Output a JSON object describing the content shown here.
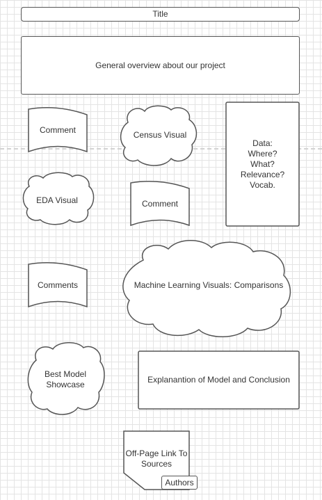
{
  "diagram": {
    "title": "Title",
    "overview": "General overview about our project",
    "comment_1": "Comment",
    "census_visual": "Census Visual",
    "data_box": {
      "line1": "Data:",
      "line2": "Where?",
      "line3": "What?",
      "line4": "Relevance?",
      "line5": "Vocab."
    },
    "eda_visual": "EDA Visual",
    "comment_2": "Comment",
    "comments": "Comments",
    "ml_visuals": "Machine Learning Visuals: Comparisons",
    "best_model_line1": "Best Model",
    "best_model_line2": "Showcase",
    "explanation": "Explanantion of Model and Conclusion",
    "off_page_line1": "Off-Page Link To",
    "off_page_line2": "Sources",
    "authors": "Authors"
  },
  "colors": {
    "stroke": "#555555",
    "text": "#333333",
    "grid": "#e4e4e4",
    "dashed_divider": "#d2d2d2"
  }
}
